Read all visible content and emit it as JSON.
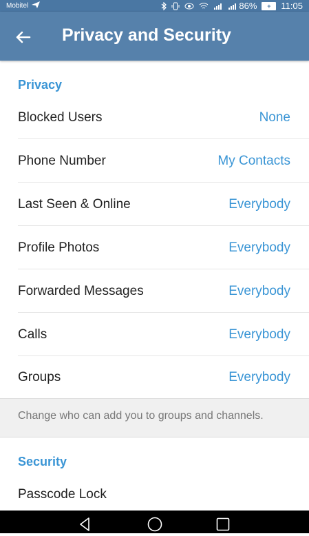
{
  "status_bar": {
    "carrier": "Mobitel",
    "battery_percent": "86%",
    "battery_charging": "+",
    "time": "11:05",
    "icons": [
      "send-icon",
      "bluetooth-icon",
      "vibrate-icon",
      "eye-icon",
      "wifi-icon",
      "signal-icon",
      "signal-icon",
      "battery-icon"
    ]
  },
  "app_bar": {
    "title": "Privacy and Security",
    "back_icon": "arrow-back-icon",
    "background": "#5681ab"
  },
  "privacy": {
    "header": "Privacy",
    "items": [
      {
        "label": "Blocked Users",
        "value": "None"
      },
      {
        "label": "Phone Number",
        "value": "My Contacts"
      },
      {
        "label": "Last Seen & Online",
        "value": "Everybody"
      },
      {
        "label": "Profile Photos",
        "value": "Everybody"
      },
      {
        "label": "Forwarded Messages",
        "value": "Everybody"
      },
      {
        "label": "Calls",
        "value": "Everybody"
      },
      {
        "label": "Groups",
        "value": "Everybody"
      }
    ],
    "info": "Change who can add you to groups and channels."
  },
  "security": {
    "header": "Security",
    "items": [
      {
        "label": "Passcode Lock"
      }
    ]
  },
  "nav_bar": {
    "buttons": [
      "back-triangle-icon",
      "home-circle-icon",
      "recents-square-icon"
    ]
  },
  "colors": {
    "accent": "#3a95d5",
    "text": "#222222",
    "muted": "#777777"
  }
}
